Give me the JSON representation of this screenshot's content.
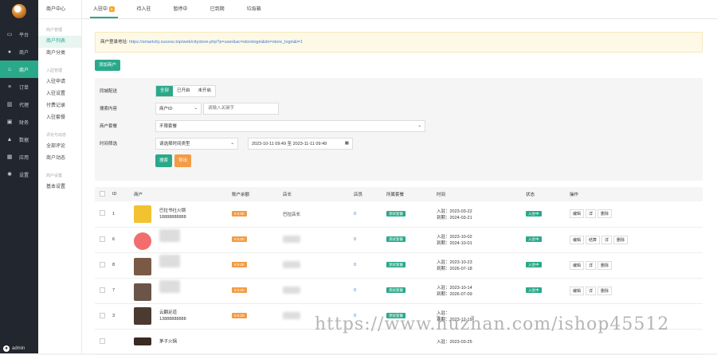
{
  "sidebar": {
    "items": [
      {
        "label": "平台",
        "icon": "monitor-icon"
      },
      {
        "label": "商户",
        "icon": "user-icon"
      },
      {
        "label": "商户",
        "icon": "shop-icon"
      },
      {
        "label": "订单",
        "icon": "list-icon"
      },
      {
        "label": "代理",
        "icon": "book-icon"
      },
      {
        "label": "财务",
        "icon": "wallet-icon"
      },
      {
        "label": "数据",
        "icon": "chart-icon"
      },
      {
        "label": "应用",
        "icon": "apps-icon"
      },
      {
        "label": "设置",
        "icon": "gear-icon"
      }
    ],
    "active_index": 2,
    "user": "admin"
  },
  "subnav": {
    "title": "商户中心",
    "groups": [
      {
        "heading": "商户管理",
        "items": [
          "商户列表",
          "商户分类"
        ]
      },
      {
        "heading": "入驻管理",
        "items": [
          "入驻申请",
          "入驻设置",
          "付费记录",
          "入驻套餐"
        ]
      },
      {
        "heading": "评论与动态",
        "items": [
          "全部评论",
          "商户动态"
        ]
      },
      {
        "heading": "商户设置",
        "items": [
          "基本设置"
        ]
      }
    ]
  },
  "tabs": [
    {
      "label": "入驻中",
      "badge": "5"
    },
    {
      "label": "待入驻"
    },
    {
      "label": "暂停中"
    },
    {
      "label": "已到期"
    },
    {
      "label": "垃圾箱"
    }
  ],
  "notice": {
    "label": "商户登录地址:",
    "url": "https://smartcity.sucess.top/web/citystore.php?p=user&ac=storelogin&do=store_login&i=1"
  },
  "add_button": "添加商户",
  "filter": {
    "delivery_label": "同城配送",
    "delivery_options": [
      "全部",
      "已开启",
      "未开启"
    ],
    "search_label": "搜索内容",
    "search_field": "商户ID",
    "search_placeholder": "请输入关键字",
    "package_label": "商户套餐",
    "package_value": "不限套餐",
    "time_label": "时间筛选",
    "time_type": "请选择时间类型",
    "date_range": "2023-10-11 09:49 至 2023-11-11 09:49",
    "search_button": "搜索",
    "export_button": "导出"
  },
  "table": {
    "headers": [
      "ID",
      "商户",
      "账户余额",
      "店长",
      "店员",
      "所属套餐",
      "时间",
      "状态",
      "操作"
    ],
    "rows": [
      {
        "id": "1",
        "name": "巴拉书社火锅",
        "phone": "18888888888",
        "balance": "¥ 0.00",
        "manager": "巴拉店长",
        "staff": "0",
        "package": "测试套餐",
        "in": "入驻：2023-03-22",
        "exp": "到期：2024-03-21",
        "status": "入驻中",
        "ops": [
          "编辑",
          "详",
          "删除"
        ]
      },
      {
        "id": "6",
        "name": "",
        "phone": "",
        "balance": "¥ 0.00",
        "manager": "",
        "staff": "0",
        "package": "测试套餐",
        "in": "入驻：2023-10-02",
        "exp": "到期：2024-10-01",
        "status": "入驻中",
        "ops": [
          "编辑",
          "结算",
          "详",
          "删除"
        ]
      },
      {
        "id": "8",
        "name": "",
        "phone": "",
        "balance": "¥ 0.00",
        "manager": "",
        "staff": "0",
        "package": "测试套餐",
        "in": "入驻：2023-10-23",
        "exp": "到期：2026-07-18",
        "status": "入驻中",
        "ops": [
          "编辑",
          "详",
          "删除"
        ]
      },
      {
        "id": "7",
        "name": "",
        "phone": "",
        "balance": "¥ 0.00",
        "manager": "",
        "staff": "0",
        "package": "测试套餐",
        "in": "入驻：2023-10-14",
        "exp": "到期：2026-07-09",
        "status": "入驻中",
        "ops": [
          "编辑",
          "详",
          "删除"
        ]
      },
      {
        "id": "3",
        "name": "云翻足道",
        "phone": "13888888888",
        "balance": "¥ 0.00",
        "manager": "",
        "staff": "0",
        "package": "测试套餐",
        "in": "入驻：",
        "exp": "到期：2023-12-19",
        "status": "",
        "ops": []
      },
      {
        "id": "",
        "name": "茅子火锅",
        "phone": "",
        "balance": "",
        "manager": "",
        "staff": "",
        "package": "",
        "in": "入驻：2023-03-25",
        "exp": "",
        "status": "",
        "ops": []
      }
    ]
  },
  "watermark": "https://www.huzhan.com/ishop45512",
  "colors": {
    "accent": "#2aa98a",
    "sidebar": "#22262e",
    "orange": "#f39c45",
    "link": "#3a7bd5"
  }
}
